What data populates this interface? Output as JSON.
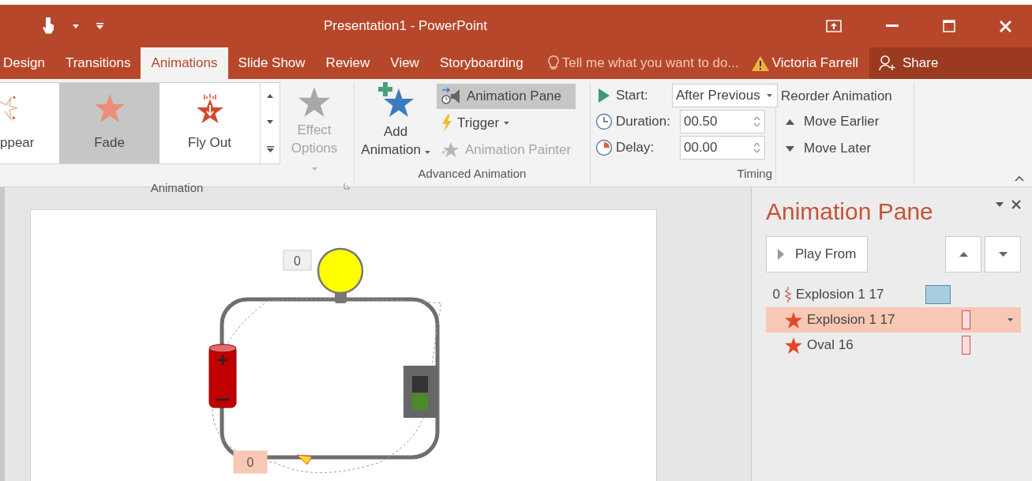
{
  "title_bar": {
    "title": "Presentation1 - PowerPoint"
  },
  "tabs": [
    {
      "label": "Design",
      "selected": false
    },
    {
      "label": "Transitions",
      "selected": false
    },
    {
      "label": "Animations",
      "selected": true
    },
    {
      "label": "Slide Show",
      "selected": false
    },
    {
      "label": "Review",
      "selected": false
    },
    {
      "label": "View",
      "selected": false
    },
    {
      "label": "Storyboarding",
      "selected": false
    }
  ],
  "tell_me": {
    "placeholder": "Tell me what you want to do..."
  },
  "user": "Victoria Farrell",
  "share": "Share",
  "ribbon": {
    "gallery": [
      {
        "label": "ppear",
        "selected": false
      },
      {
        "label": "Fade",
        "selected": true
      },
      {
        "label": "Fly Out",
        "selected": false
      }
    ],
    "effect_options": {
      "label": "Effect Options",
      "disabled": true
    },
    "animation_group": "Animation",
    "add_animation": "Add Animation",
    "animation_pane_button": {
      "label": "Animation Pane",
      "selected": true
    },
    "trigger": "Trigger",
    "animation_painter": {
      "label": "Animation Painter",
      "disabled": true
    },
    "advanced_group": "Advanced Animation",
    "timing": {
      "start_label": "Start:",
      "start_value": "After Previous",
      "duration_label": "Duration:",
      "duration_value": "00.50",
      "delay_label": "Delay:",
      "delay_value": "00.00",
      "group": "Timing"
    },
    "reorder": {
      "title": "Reorder Animation",
      "earlier": "Move Earlier",
      "later": "Move Later"
    }
  },
  "slide": {
    "markers": [
      {
        "label": "0",
        "kind": "plain"
      },
      {
        "label": "0",
        "kind": "highlighted"
      }
    ]
  },
  "pane": {
    "title": "Animation Pane",
    "play_from": "Play From",
    "items": [
      {
        "index": "0",
        "name": "Explosion 1 17",
        "kind": "trigger",
        "selected": false
      },
      {
        "name": "Explosion 1 17",
        "kind": "effect",
        "selected": true
      },
      {
        "name": "Oval 16",
        "kind": "effect",
        "selected": false
      }
    ]
  }
}
